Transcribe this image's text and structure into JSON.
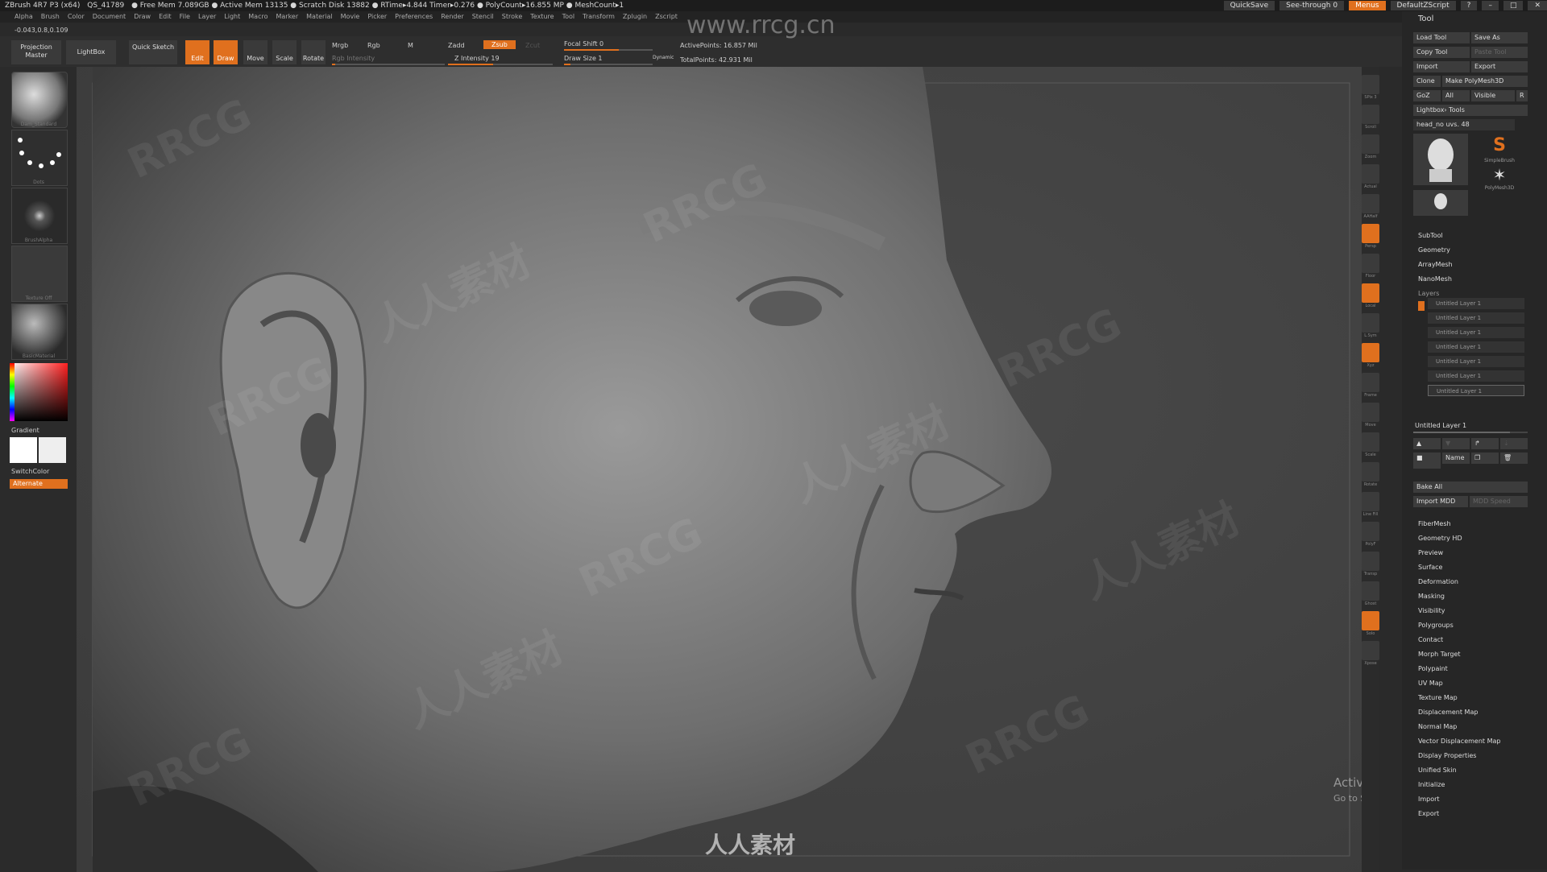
{
  "title_bar": {
    "app": "ZBrush 4R7 P3 (x64)",
    "file": "QS_41789",
    "stats": "● Free Mem 7.089GB ● Active Mem 13135 ● Scratch Disk 13882 ● RTime▸4.844 Timer▸0.276 ● PolyCount▸16.855 MP ● MeshCount▸1",
    "quicksave": "QuickSave",
    "see_through": "See-through  0",
    "menus": "Menus",
    "script": "DefaultZScript"
  },
  "menubar": [
    "Alpha",
    "Brush",
    "Color",
    "Document",
    "Draw",
    "Edit",
    "File",
    "Layer",
    "Light",
    "Macro",
    "Marker",
    "Material",
    "Movie",
    "Picker",
    "Preferences",
    "Render",
    "Stencil",
    "Stroke",
    "Texture",
    "Tool",
    "Transform",
    "Zplugin",
    "Zscript"
  ],
  "coords": "-0.043,0.8,0.109",
  "shelf": {
    "projection_master": "Projection Master",
    "lightbox": "LightBox",
    "quick_sketch": "Quick Sketch",
    "edit": "Edit",
    "draw": "Draw",
    "move": "Move",
    "scale": "Scale",
    "rotate": "Rotate",
    "mrgb": "Mrgb",
    "rgb": "Rgb",
    "m": "M",
    "rgb_intensity": "Rgb Intensity",
    "zadd": "Zadd",
    "zsub": "Zsub",
    "zcut": "Zcut",
    "z_intensity": "Z Intensity 19",
    "focal_shift": "Focal Shift 0",
    "draw_size": "Draw Size 1",
    "dynamic": "Dynamic",
    "active_points": "ActivePoints: 16.857 Mil",
    "total_points": "TotalPoints: 42.931 Mil"
  },
  "left_panel": {
    "brush_label": "Dam_Standard",
    "stroke_label": "Dots",
    "alpha_label": "BrushAlpha",
    "texture_label": "Texture Off",
    "material_label": "BasicMaterial",
    "gradient": "Gradient",
    "switch_color": "SwitchColor",
    "alternate": "Alternate"
  },
  "watermark_site": "www.rrcg.cn",
  "watermark_brand": "RRCG",
  "watermark_cn": "人人素材",
  "right_toolbar": [
    "SPix 3",
    "Scroll",
    "Zoom",
    "Actual",
    "AAHalf",
    "Persp",
    "Floor",
    "Local",
    "L.Sym",
    "Xyz",
    "Frame",
    "Move",
    "Scale",
    "Rotate",
    "Line Fill",
    "PolyF",
    "Transp",
    "Ghost",
    "Solo",
    "Xpose"
  ],
  "right_panel": {
    "tool": "Tool",
    "load_tool": "Load Tool",
    "save_as": "Save As",
    "copy_tool": "Copy Tool",
    "paste_tool": "Paste Tool",
    "import": "Import",
    "export": "Export",
    "clone": "Clone",
    "make_polymesh": "Make PolyMesh3D",
    "goz": "GoZ",
    "all": "All",
    "visible": "Visible",
    "r": "R",
    "lightbox_tools": "Lightbox› Tools",
    "current_tool": "head_no uvs. 48",
    "tool_thumbs": [
      "head_no uvs",
      "SimpleBrush",
      "PolyMesh3D",
      "head_no uvs"
    ],
    "sections_top": [
      "SubTool",
      "Geometry",
      "ArrayMesh",
      "NanoMesh"
    ],
    "layers": "Layers",
    "layer_rows": [
      "Untitled Layer 1",
      "Untitled Layer 1",
      "Untitled Layer 1",
      "Untitled Layer 1",
      "Untitled Layer 1",
      "Untitled Layer 1",
      "Untitled Layer 1"
    ],
    "layer_current": "Untitled Layer 1",
    "name": "Name",
    "bake_all": "Bake All",
    "import_mdd": "Import MDD",
    "mdd_speed": "MDD Speed",
    "sections_bottom": [
      "FiberMesh",
      "Geometry HD",
      "Preview",
      "Surface",
      "Deformation",
      "Masking",
      "Visibility",
      "Polygroups",
      "Contact",
      "Morph Target",
      "Polypaint",
      "UV Map",
      "Texture Map",
      "Displacement Map",
      "Normal Map",
      "Vector Displacement Map",
      "Display Properties",
      "Unified Skin",
      "Initialize",
      "Import",
      "Export"
    ]
  },
  "activate_windows": {
    "title": "Activate Windows",
    "subtitle": "Go to Settings to activate Windows."
  }
}
